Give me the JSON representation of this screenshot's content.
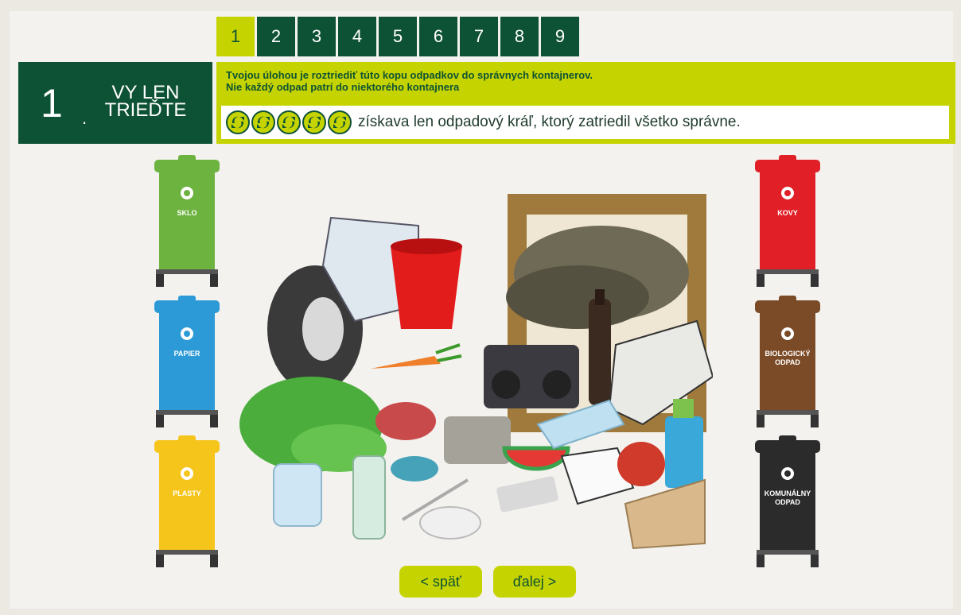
{
  "steps": [
    "1",
    "2",
    "3",
    "4",
    "5",
    "6",
    "7",
    "8",
    "9"
  ],
  "active_step": "1",
  "title": {
    "number": "1",
    "dot": ".",
    "line1": "VY LEN",
    "line2": "TRIEĎTE"
  },
  "instruction": {
    "line1": "Tvojou úlohou je roztriediť túto kopu odpadkov do správnych kontajnerov.",
    "line2": "Nie každý odpad patrí do niektorého kontajnera",
    "reward_text": "získava len odpadový kráľ, ktorý zatriedil všetko správne.",
    "coin_count": 5
  },
  "bins_left": [
    {
      "label": "SKLO",
      "color": "#6db33f"
    },
    {
      "label": "PAPIER",
      "color": "#2c9ad6"
    },
    {
      "label": "PLASTY",
      "color": "#f6c51b"
    }
  ],
  "bins_right": [
    {
      "label": "KOVY",
      "color": "#e01f26"
    },
    {
      "label": "BIOLOGICKÝ ODPAD",
      "color": "#7b4a26"
    },
    {
      "label": "KOMUNÁLNY ODPAD",
      "color": "#2b2b2b"
    }
  ],
  "buttons": {
    "back": "< späť",
    "next": "ďalej >"
  },
  "colors": {
    "dark_green": "#0e5235",
    "lime": "#c5d400"
  },
  "pile_items": [
    "picture-frame",
    "dry-leaves",
    "tire",
    "red-bucket",
    "magazine",
    "carrot",
    "radio",
    "wine-bottle",
    "newspaper",
    "lettuce",
    "glass-jar",
    "glass-bottle",
    "steak",
    "tin-can",
    "egg-carton",
    "watermelon",
    "plastic-bottle",
    "pill-blister",
    "plate",
    "fork",
    "notebook",
    "spray-bottle",
    "pizza-box",
    "apple-core"
  ]
}
